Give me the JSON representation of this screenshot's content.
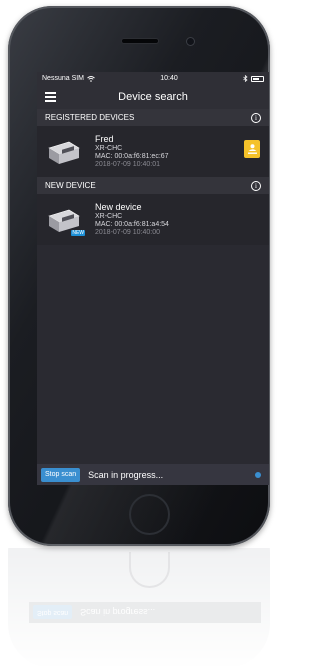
{
  "status": {
    "carrier": "Nessuna SIM",
    "time": "10:40"
  },
  "header": {
    "title": "Device search"
  },
  "sections": {
    "registered": {
      "title": "REGISTERED DEVICES",
      "device": {
        "name": "Fred",
        "model": "XR-CHC",
        "mac": "MAC: 00:0a:f6:81:ec:67",
        "timestamp": "2018-07-09 10:40:01"
      }
    },
    "new": {
      "title": "NEW DEVICE",
      "device": {
        "name": "New device",
        "model": "XR-CHC",
        "mac": "MAC: 00:0a:f6:81:a4:54",
        "timestamp": "2018-07-09 10:40:00",
        "badge": "NEW"
      }
    }
  },
  "scan": {
    "button_label": "Stop scan",
    "status_text": "Scan in progress..."
  },
  "colors": {
    "accent": "#3a8fd0",
    "action": "#f5c22a",
    "screen_bg": "#2a2a31"
  },
  "icons": {
    "menu": "hamburger-menu-icon",
    "info": "info-icon",
    "action": "user-download-icon"
  }
}
